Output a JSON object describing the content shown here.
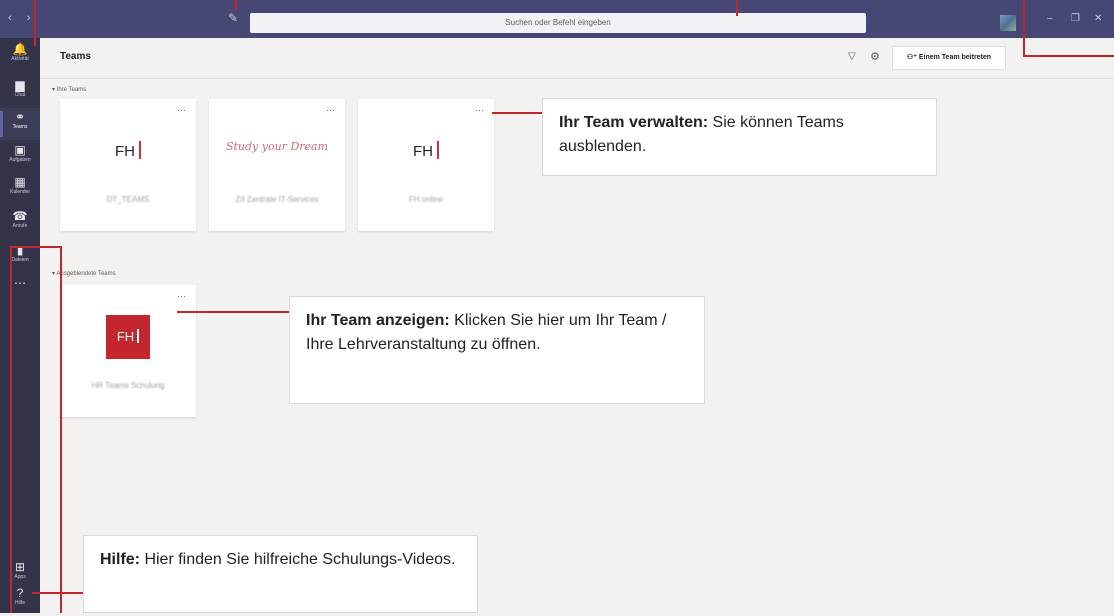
{
  "titlebar": {
    "nav_arrows": "‹  ›",
    "search_placeholder": "Suchen oder Befehl eingeben",
    "minimize": "–",
    "maximize": "❐",
    "close": "✕"
  },
  "rail": [
    {
      "label": "Aktivität",
      "icon": "bell-icon",
      "glyph": "🔔"
    },
    {
      "label": "Chat",
      "icon": "chat-icon",
      "glyph": "▆"
    },
    {
      "label": "Teams",
      "icon": "teams-icon",
      "glyph": "⚭"
    },
    {
      "label": "Aufgaben",
      "icon": "assignments-icon",
      "glyph": "▣"
    },
    {
      "label": "Kalender",
      "icon": "calendar-icon",
      "glyph": "▦"
    },
    {
      "label": "Anrufe",
      "icon": "phone-icon",
      "glyph": "☎"
    },
    {
      "label": "Dateien",
      "icon": "files-icon",
      "glyph": "▮"
    },
    {
      "label": "",
      "icon": "more-icon",
      "glyph": "⋯"
    }
  ],
  "rail_bottom": [
    {
      "label": "Apps",
      "icon": "apps-icon",
      "glyph": "⊞"
    },
    {
      "label": "Hilfe",
      "icon": "help-icon",
      "glyph": "?"
    }
  ],
  "header": {
    "title": "Teams",
    "join_button": "Einem Team beitreten"
  },
  "sections": {
    "your_teams": "Ihre Teams",
    "hidden_teams": "Ausgeblendete Teams"
  },
  "teams": [
    {
      "logo_text": "FH",
      "name": "DT_TEAMS"
    },
    {
      "logo_text": "Study your Dream",
      "name": "Z/I Zentrale IT-Services"
    },
    {
      "logo_text": "FH",
      "name": "FH online"
    }
  ],
  "hidden_teams": [
    {
      "logo_text": "FH",
      "name": "HR Teams Schulung"
    }
  ],
  "callouts": {
    "manage": {
      "bold": "Ihr Team verwalten:",
      "text": " Sie können Teams ausblenden."
    },
    "show": {
      "bold": "Ihr Team anzeigen:",
      "text": " Klicken Sie hier um Ihr Team / Ihre Lehrveranstaltung zu öffnen."
    },
    "help": {
      "bold": "Hilfe:",
      "text": " Hier finden Sie hilfreiche Schulungs-Videos."
    }
  },
  "colors": {
    "titlebar": "#464775",
    "rail": "#33344a",
    "accent": "#6264a7",
    "annotation": "#c4262e"
  }
}
